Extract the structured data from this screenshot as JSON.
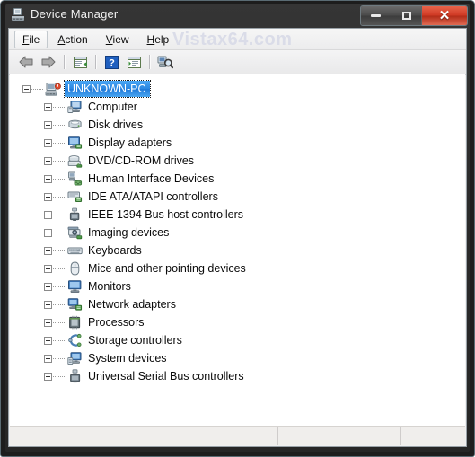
{
  "window": {
    "title": "Device Manager",
    "title_icon": "device-manager-icon",
    "controls": {
      "minimize_label": "Minimize",
      "maximize_label": "Maximize",
      "close_label": "Close"
    }
  },
  "watermark": "Vistax64.com",
  "menubar": {
    "items": [
      {
        "label": "File",
        "accel": "F",
        "active": true
      },
      {
        "label": "Action",
        "accel": "A",
        "active": false
      },
      {
        "label": "View",
        "accel": "V",
        "active": false
      },
      {
        "label": "Help",
        "accel": "H",
        "active": false
      }
    ]
  },
  "toolbar": {
    "buttons": [
      {
        "name": "back-button",
        "icon": "back-arrow-icon",
        "enabled": true
      },
      {
        "name": "forward-button",
        "icon": "forward-arrow-icon",
        "enabled": true
      },
      {
        "name": "separator-1",
        "icon": "separator",
        "enabled": false
      },
      {
        "name": "properties-button",
        "icon": "properties-icon",
        "enabled": true
      },
      {
        "name": "separator-2",
        "icon": "separator",
        "enabled": false
      },
      {
        "name": "help-button",
        "icon": "help-question-icon",
        "enabled": true
      },
      {
        "name": "show-hidden-button",
        "icon": "show-hidden-devices-icon",
        "enabled": true
      },
      {
        "name": "separator-3",
        "icon": "separator",
        "enabled": false
      },
      {
        "name": "scan-hardware-button",
        "icon": "scan-hardware-changes-icon",
        "enabled": true
      }
    ]
  },
  "tree": {
    "root": {
      "label": "UNKNOWN-PC",
      "icon": "computer-root-icon",
      "expanded": true,
      "selected": true
    },
    "children": [
      {
        "label": "Computer",
        "icon": "computer-icon",
        "expanded": false
      },
      {
        "label": "Disk drives",
        "icon": "disk-drive-icon",
        "expanded": false
      },
      {
        "label": "Display adapters",
        "icon": "display-adapter-icon",
        "expanded": false
      },
      {
        "label": "DVD/CD-ROM drives",
        "icon": "dvd-cdrom-icon",
        "expanded": false
      },
      {
        "label": "Human Interface Devices",
        "icon": "hid-icon",
        "expanded": false
      },
      {
        "label": "IDE ATA/ATAPI controllers",
        "icon": "ide-controller-icon",
        "expanded": false
      },
      {
        "label": "IEEE 1394 Bus host controllers",
        "icon": "ieee1394-icon",
        "expanded": false
      },
      {
        "label": "Imaging devices",
        "icon": "imaging-device-icon",
        "expanded": false
      },
      {
        "label": "Keyboards",
        "icon": "keyboard-icon",
        "expanded": false
      },
      {
        "label": "Mice and other pointing devices",
        "icon": "mouse-icon",
        "expanded": false
      },
      {
        "label": "Monitors",
        "icon": "monitor-icon",
        "expanded": false
      },
      {
        "label": "Network adapters",
        "icon": "network-adapter-icon",
        "expanded": false
      },
      {
        "label": "Processors",
        "icon": "processor-icon",
        "expanded": false
      },
      {
        "label": "Storage controllers",
        "icon": "storage-controller-icon",
        "expanded": false
      },
      {
        "label": "System devices",
        "icon": "system-device-icon",
        "expanded": false
      },
      {
        "label": "Universal Serial Bus controllers",
        "icon": "usb-controller-icon",
        "expanded": false
      }
    ]
  },
  "statusbar": {
    "pane1": "",
    "pane2": "",
    "pane3": ""
  },
  "colors": {
    "titlebar": "#2b2b2b",
    "selection_blue": "#2b86e0",
    "close_red": "#cf3a24",
    "client_bg": "#ffffff",
    "watermark": "#dadce8"
  }
}
